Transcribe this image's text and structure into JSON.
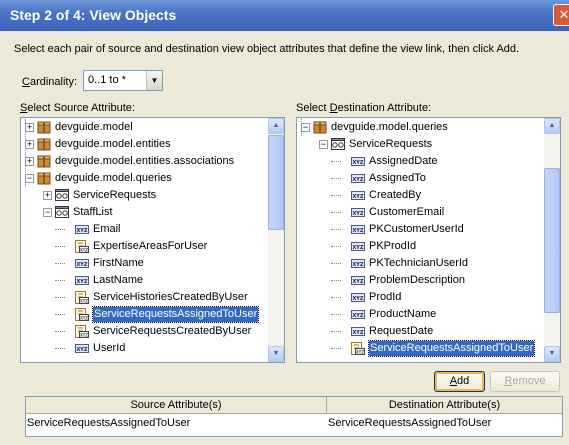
{
  "window": {
    "title": "Step 2 of 4: View Objects",
    "close_glyph": "✕"
  },
  "instructions": "Select each pair of source and destination view object attributes that define the view link, then click Add.",
  "cardinality": {
    "label_prefix": "",
    "label_mnemonic": "C",
    "label_rest": "ardinality:",
    "value": "0..1 to *"
  },
  "source": {
    "label_prefix": "",
    "label_mnemonic": "S",
    "label_rest": "elect Source Attribute:",
    "nodes": [
      {
        "text": "devguide.model",
        "icon": "package-icon",
        "level": 0,
        "expander": "+"
      },
      {
        "text": "devguide.model.entities",
        "icon": "package-icon",
        "level": 0,
        "expander": "+"
      },
      {
        "text": "devguide.model.entities.associations",
        "icon": "package-icon",
        "level": 0,
        "expander": "+"
      },
      {
        "text": "devguide.model.queries",
        "icon": "package-icon",
        "level": 0,
        "expander": "-"
      },
      {
        "text": "ServiceRequests",
        "icon": "view-object-icon",
        "level": 1,
        "expander": "+"
      },
      {
        "text": "StaffList",
        "icon": "view-object-icon",
        "level": 1,
        "expander": "-"
      },
      {
        "text": "Email",
        "icon": "attribute-icon",
        "level": 2,
        "expander": ""
      },
      {
        "text": "ExpertiseAreasForUser",
        "icon": "accessor-icon",
        "level": 2,
        "expander": ""
      },
      {
        "text": "FirstName",
        "icon": "attribute-icon",
        "level": 2,
        "expander": ""
      },
      {
        "text": "LastName",
        "icon": "attribute-icon",
        "level": 2,
        "expander": ""
      },
      {
        "text": "ServiceHistoriesCreatedByUser",
        "icon": "accessor-icon",
        "level": 2,
        "expander": ""
      },
      {
        "text": "ServiceRequestsAssignedToUser",
        "icon": "accessor-icon",
        "level": 2,
        "expander": "",
        "selected": true
      },
      {
        "text": "ServiceRequestsCreatedByUser",
        "icon": "accessor-icon",
        "level": 2,
        "expander": ""
      },
      {
        "text": "UserId",
        "icon": "attribute-icon",
        "level": 2,
        "expander": ""
      }
    ]
  },
  "destination": {
    "label_prefix": "Select ",
    "label_mnemonic": "D",
    "label_rest": "estination Attribute:",
    "nodes": [
      {
        "text": "devguide.model.queries",
        "icon": "package-icon",
        "level": 0,
        "expander": "-"
      },
      {
        "text": "ServiceRequests",
        "icon": "view-object-icon",
        "level": 1,
        "expander": "-"
      },
      {
        "text": "AssignedDate",
        "icon": "attribute-icon",
        "level": 2,
        "expander": ""
      },
      {
        "text": "AssignedTo",
        "icon": "attribute-icon",
        "level": 2,
        "expander": ""
      },
      {
        "text": "CreatedBy",
        "icon": "attribute-icon",
        "level": 2,
        "expander": ""
      },
      {
        "text": "CustomerEmail",
        "icon": "attribute-icon",
        "level": 2,
        "expander": ""
      },
      {
        "text": "PKCustomerUserId",
        "icon": "attribute-icon",
        "level": 2,
        "expander": ""
      },
      {
        "text": "PKProdId",
        "icon": "attribute-icon",
        "level": 2,
        "expander": ""
      },
      {
        "text": "PKTechnicianUserId",
        "icon": "attribute-icon",
        "level": 2,
        "expander": ""
      },
      {
        "text": "ProblemDescription",
        "icon": "attribute-icon",
        "level": 2,
        "expander": ""
      },
      {
        "text": "ProdId",
        "icon": "attribute-icon",
        "level": 2,
        "expander": ""
      },
      {
        "text": "ProductName",
        "icon": "attribute-icon",
        "level": 2,
        "expander": ""
      },
      {
        "text": "RequestDate",
        "icon": "attribute-icon",
        "level": 2,
        "expander": ""
      },
      {
        "text": "ServiceRequestsAssignedToUser",
        "icon": "accessor-icon",
        "level": 2,
        "expander": "",
        "selected": true
      }
    ]
  },
  "buttons": {
    "add_mnemonic": "A",
    "add_rest": "dd",
    "remove_mnemonic": "R",
    "remove_rest": "emove"
  },
  "pairs_table": {
    "columns": [
      "Source Attribute(s)",
      "Destination Attribute(s)"
    ],
    "rows": [
      [
        "ServiceRequestsAssignedToUser",
        "ServiceRequestsAssignedToUser"
      ]
    ]
  }
}
